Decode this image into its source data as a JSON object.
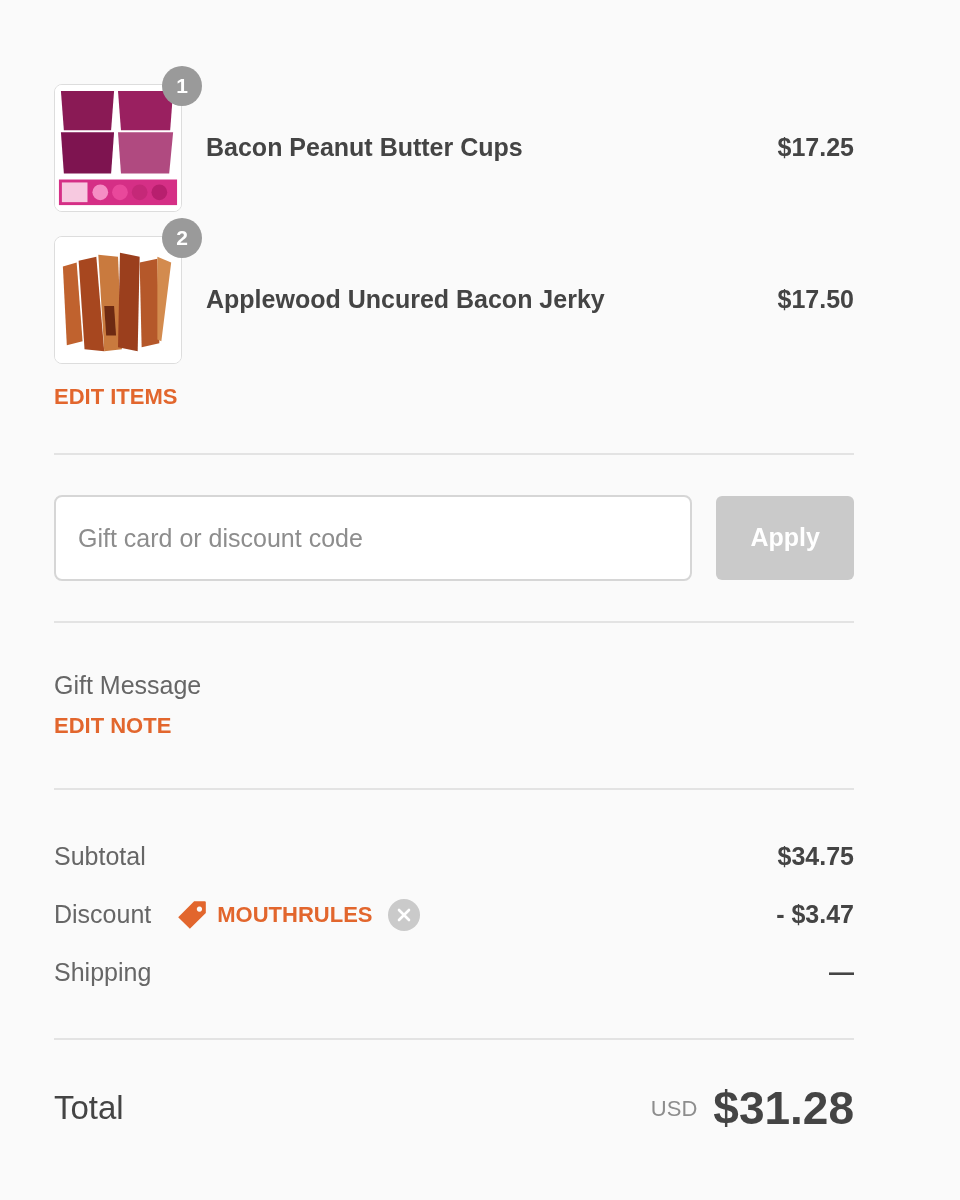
{
  "items": [
    {
      "name": "Bacon Peanut Butter Cups",
      "price": "$17.25",
      "quantity": "1"
    },
    {
      "name": "Applewood Uncured Bacon Jerky",
      "price": "$17.50",
      "quantity": "2"
    }
  ],
  "edit_items_link": "EDIT ITEMS",
  "discount_form": {
    "placeholder": "Gift card or discount code",
    "button": {
      "label": "Apply",
      "disabled": true
    }
  },
  "gift_message": {
    "label": "Gift Message",
    "link": "EDIT NOTE"
  },
  "summary": [
    {
      "kind": "plain",
      "label": "Subtotal",
      "value": "$34.75"
    },
    {
      "kind": "discount",
      "label": "Discount",
      "code": "MOUTHRULES",
      "value": "- $3.47"
    },
    {
      "kind": "plain",
      "label": "Shipping",
      "value": "—"
    }
  ],
  "total": {
    "label": "Total",
    "currency": "USD",
    "value": "$31.28"
  }
}
